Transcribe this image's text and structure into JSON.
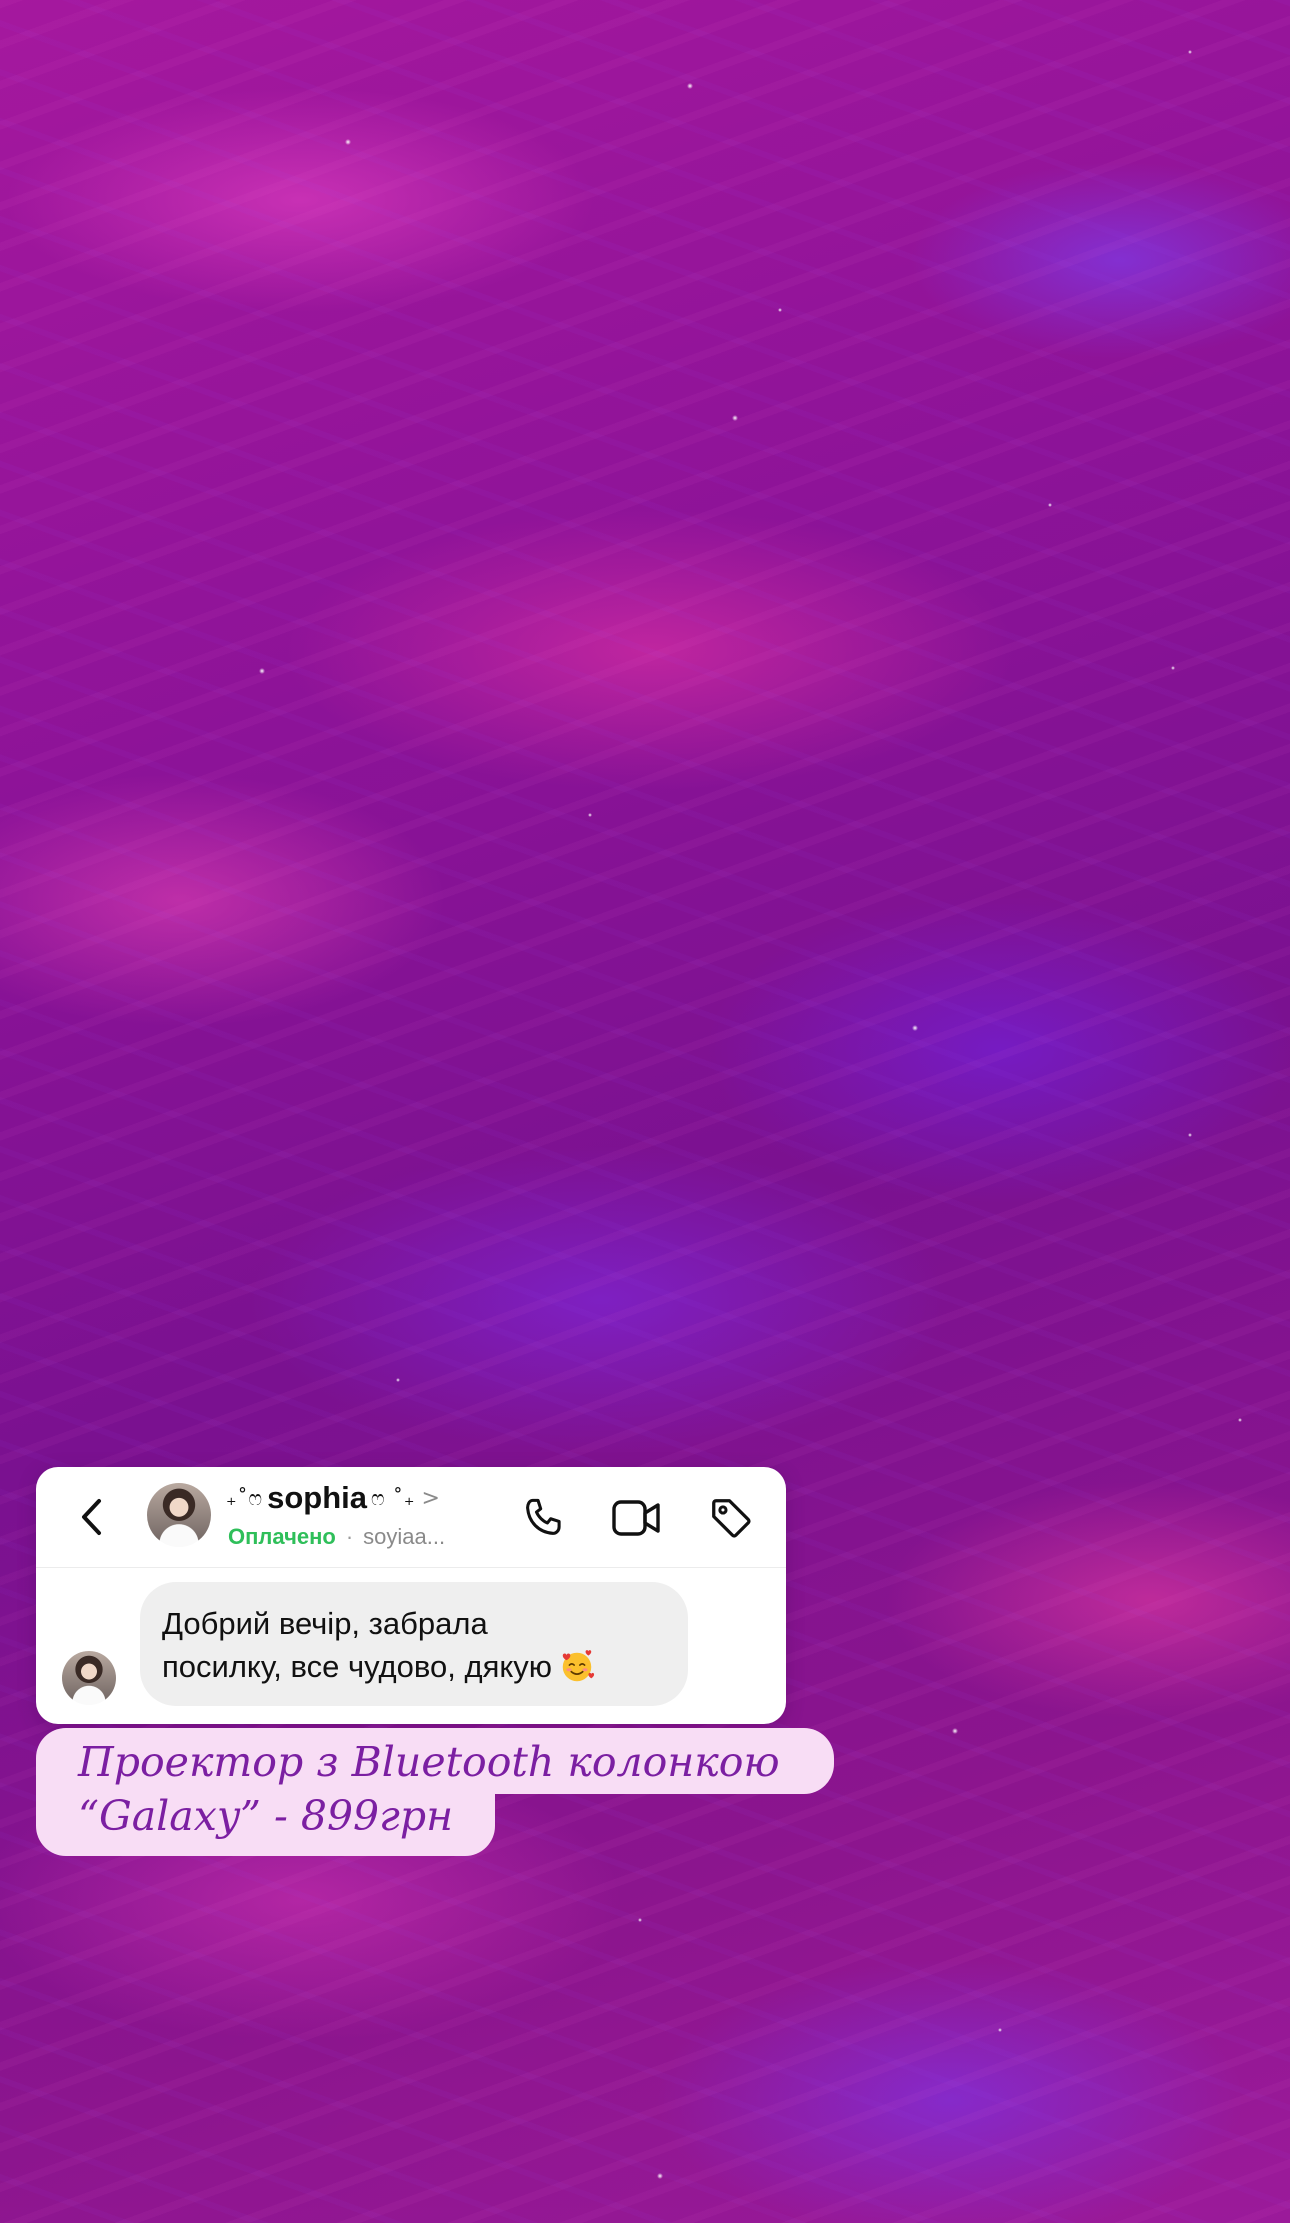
{
  "chat": {
    "name_prefix": "₊˚ෆ",
    "name": "sophia",
    "name_suffix": "ෆ ˚₊",
    "chevron": ">",
    "status": "Оплачено",
    "separator": "·",
    "username": "soyiaa...",
    "message_line_1": "Добрий вечір, забрала",
    "message_line_2": "посилку, все чудово, дякую",
    "message_emoji": "smiling-face-with-hearts-emoji"
  },
  "caption": {
    "line_1": "Проектор з Bluetooth колонкою",
    "line_2": "“Galaxy” - 899грн"
  },
  "icons": {
    "back": "chevron-left-icon",
    "call": "phone-icon",
    "video": "video-camera-icon",
    "tag": "tag-icon"
  },
  "colors": {
    "status_green": "#2fbf5a",
    "caption_text": "#7b1fa2",
    "caption_bg": "#f8ddf5",
    "background": "#8a1690"
  }
}
